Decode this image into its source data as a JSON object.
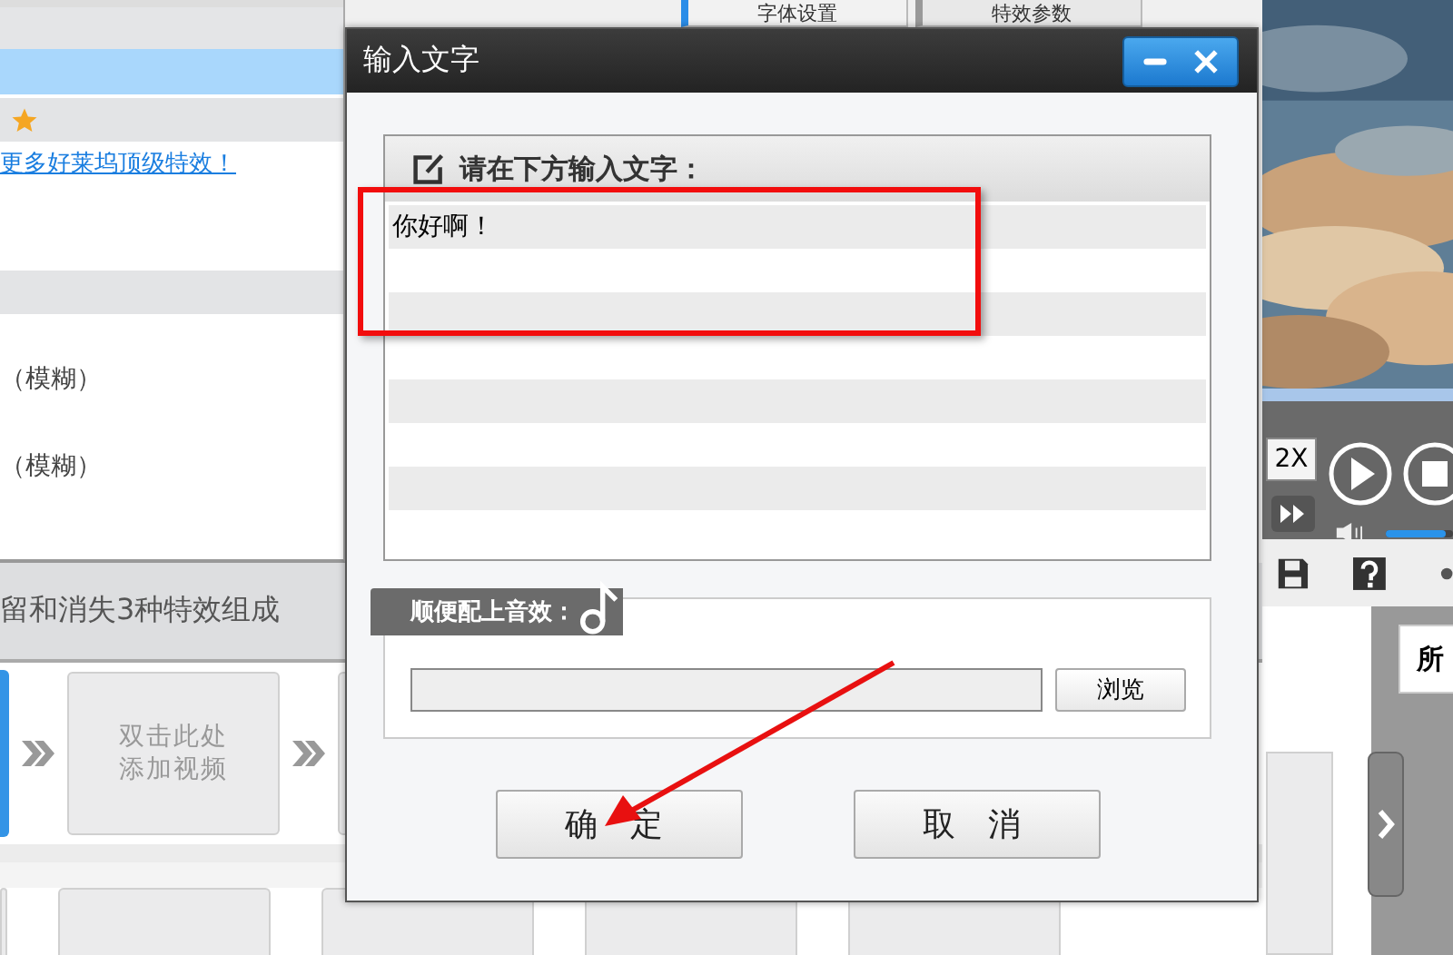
{
  "left_panel": {
    "link": "更多好莱坞顶级特效！",
    "effects": [
      "（模糊）",
      "（模糊）"
    ]
  },
  "tabs": [
    {
      "label": "字体设置",
      "selected": true
    },
    {
      "label": "特效参数",
      "selected": false
    }
  ],
  "description": "留和消失3种特效组成",
  "storyboard": {
    "card_lines": [
      "双击此处",
      "添加视频"
    ]
  },
  "player": {
    "speed": "2X",
    "volume": {
      "level": 0.9
    }
  },
  "side_tab": "所",
  "dialog": {
    "title": "输入文字",
    "prompt": "请在下方输入文字：",
    "lines": [
      "你好啊！"
    ],
    "sound_label": "顺便配上音效：",
    "browse": "浏览",
    "ok": "确 定",
    "cancel": "取 消"
  }
}
